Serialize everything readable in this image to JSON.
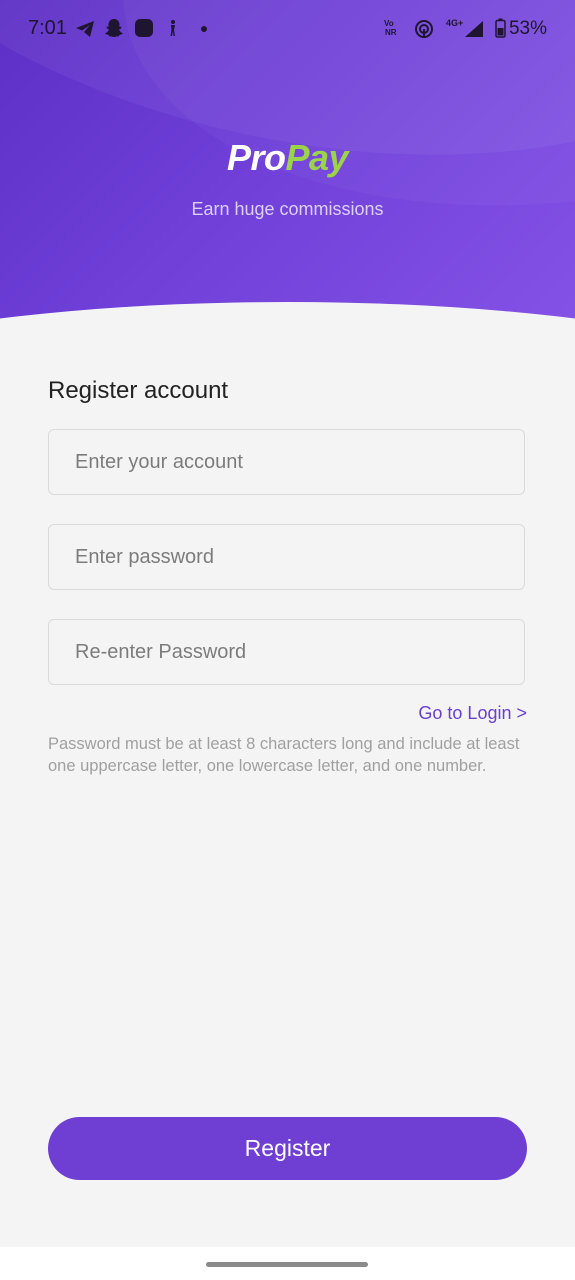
{
  "status_bar": {
    "time": "7:01",
    "network_label_top": "Vo",
    "network_label_bottom": "NR",
    "network_type": "4G+",
    "battery": "53%"
  },
  "brand": {
    "logo_part1": "Pro",
    "logo_part2": "Pay",
    "tagline": "Earn huge commissions"
  },
  "form": {
    "title": "Register account",
    "account_placeholder": "Enter your account",
    "password_placeholder": "Enter password",
    "reenter_placeholder": "Re-enter Password",
    "login_link": "Go to Login >",
    "hint": "Password must be at least 8 characters long and include at least one uppercase letter, one lowercase letter, and one number.",
    "register_label": "Register"
  },
  "colors": {
    "brand_purple": "#6e3fd2",
    "logo_green": "#9bd34a"
  },
  "icons": {
    "status": [
      "telegram-icon",
      "snapchat-icon",
      "app-icon",
      "figure-icon",
      "dot-icon",
      "hotspot-icon",
      "signal-icon",
      "battery-icon"
    ]
  }
}
